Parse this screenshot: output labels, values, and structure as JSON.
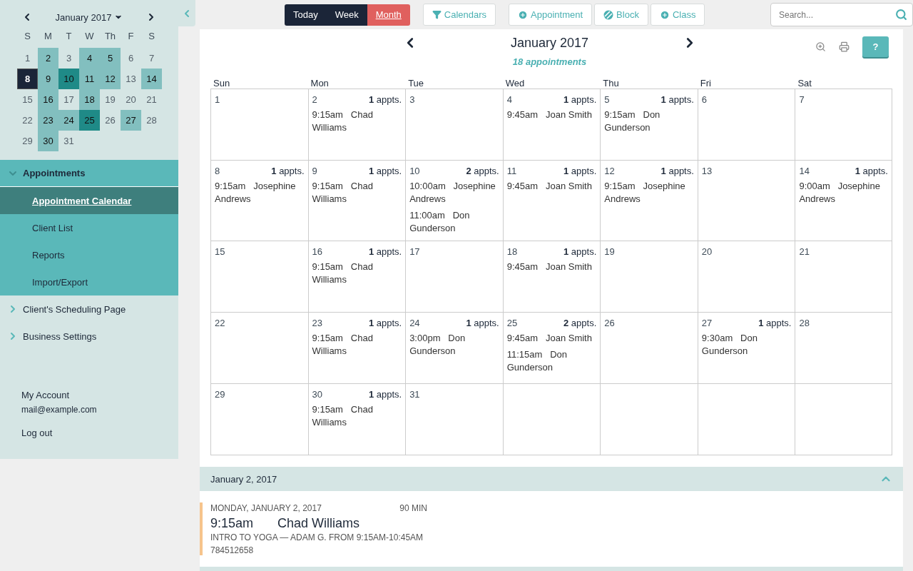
{
  "mini_calendar": {
    "month": "January 2017",
    "weekdays": [
      "S",
      "M",
      "T",
      "W",
      "Th",
      "F",
      "S"
    ],
    "days": [
      {
        "day": "1",
        "kind": "plain",
        "selected": false
      },
      {
        "day": "2",
        "kind": "busy",
        "selected": false
      },
      {
        "day": "3",
        "kind": "plain",
        "selected": false
      },
      {
        "day": "4",
        "kind": "busy",
        "selected": false
      },
      {
        "day": "5",
        "kind": "busy",
        "selected": false
      },
      {
        "day": "6",
        "kind": "plain",
        "selected": false
      },
      {
        "day": "7",
        "kind": "plain",
        "selected": false
      },
      {
        "day": "8",
        "kind": "busy",
        "selected": true
      },
      {
        "day": "9",
        "kind": "busy",
        "selected": false
      },
      {
        "day": "10",
        "kind": "busier",
        "selected": false
      },
      {
        "day": "11",
        "kind": "busy",
        "selected": false
      },
      {
        "day": "12",
        "kind": "busy",
        "selected": false
      },
      {
        "day": "13",
        "kind": "plain",
        "selected": false
      },
      {
        "day": "14",
        "kind": "busy",
        "selected": false
      },
      {
        "day": "15",
        "kind": "plain",
        "selected": false
      },
      {
        "day": "16",
        "kind": "busy",
        "selected": false
      },
      {
        "day": "17",
        "kind": "plain",
        "selected": false
      },
      {
        "day": "18",
        "kind": "busy",
        "selected": false
      },
      {
        "day": "19",
        "kind": "plain",
        "selected": false
      },
      {
        "day": "20",
        "kind": "plain",
        "selected": false
      },
      {
        "day": "21",
        "kind": "plain",
        "selected": false
      },
      {
        "day": "22",
        "kind": "plain",
        "selected": false
      },
      {
        "day": "23",
        "kind": "busy",
        "selected": false
      },
      {
        "day": "24",
        "kind": "busy",
        "selected": false
      },
      {
        "day": "25",
        "kind": "busier",
        "selected": false
      },
      {
        "day": "26",
        "kind": "plain",
        "selected": false
      },
      {
        "day": "27",
        "kind": "busy",
        "selected": false
      },
      {
        "day": "28",
        "kind": "plain",
        "selected": false
      },
      {
        "day": "29",
        "kind": "plain",
        "selected": false
      },
      {
        "day": "30",
        "kind": "busy",
        "selected": false
      },
      {
        "day": "31",
        "kind": "plain",
        "selected": false
      }
    ]
  },
  "nav": [
    {
      "label": "Appointments",
      "expanded": true,
      "children": [
        {
          "label": "Appointment Calendar",
          "selected": true
        },
        {
          "label": "Client List",
          "selected": false
        },
        {
          "label": "Reports",
          "selected": false
        },
        {
          "label": "Import/Export",
          "selected": false
        }
      ]
    },
    {
      "label": "Client's Scheduling Page",
      "expanded": false
    },
    {
      "label": "Business Settings",
      "expanded": false
    }
  ],
  "account": {
    "label": "My Account",
    "email": "mail@example.com",
    "logout": "Log out"
  },
  "view_toggle": [
    {
      "label": "Today",
      "selected": false
    },
    {
      "label": "Week",
      "selected": false
    },
    {
      "label": "Month",
      "selected": true
    }
  ],
  "filter_button": "Calendars",
  "add_buttons": [
    "Appointment",
    "Block",
    "Class"
  ],
  "search": {
    "placeholder": "Search..."
  },
  "calendar": {
    "title": "January 2017",
    "summary": "18 appointments",
    "help": "?",
    "weekdays": [
      "Sun",
      "Mon",
      "Tue",
      "Wed",
      "Thu",
      "Fri",
      "Sat"
    ],
    "weeks": [
      [
        {
          "day": "1"
        },
        {
          "day": "2",
          "count": "**1** appts.",
          "appointments": [
            {
              "time": "9:15am",
              "name": "Chad Williams"
            }
          ]
        },
        {
          "day": "3"
        },
        {
          "day": "4",
          "count": "**1** appts.",
          "appointments": [
            {
              "time": "9:45am",
              "name": "Joan Smith"
            }
          ]
        },
        {
          "day": "5",
          "count": "**1** appts.",
          "appointments": [
            {
              "time": "9:15am",
              "name": "Don Gunderson"
            }
          ]
        },
        {
          "day": "6"
        },
        {
          "day": "7"
        }
      ],
      [
        {
          "day": "8",
          "count": "**1** appts.",
          "appointments": [
            {
              "time": "9:15am",
              "name": "Josephine Andrews"
            }
          ]
        },
        {
          "day": "9",
          "count": "**1** appts.",
          "appointments": [
            {
              "time": "9:15am",
              "name": "Chad Williams"
            }
          ]
        },
        {
          "day": "10",
          "count": "**2** appts.",
          "appointments": [
            {
              "time": "10:00am",
              "name": "Josephine Andrews"
            },
            {
              "time": "11:00am",
              "name": "Don Gunderson"
            }
          ]
        },
        {
          "day": "11",
          "count": "**1** appts.",
          "appointments": [
            {
              "time": "9:45am",
              "name": "Joan Smith"
            }
          ]
        },
        {
          "day": "12",
          "count": "**1** appts.",
          "appointments": [
            {
              "time": "9:15am",
              "name": "Josephine Andrews"
            }
          ]
        },
        {
          "day": "13"
        },
        {
          "day": "14",
          "count": "**1** appts.",
          "appointments": [
            {
              "time": "9:00am",
              "name": "Josephine Andrews"
            }
          ]
        }
      ],
      [
        {
          "day": "15"
        },
        {
          "day": "16",
          "count": "**1** appts.",
          "appointments": [
            {
              "time": "9:15am",
              "name": "Chad Williams"
            }
          ]
        },
        {
          "day": "17"
        },
        {
          "day": "18",
          "count": "**1** appts.",
          "appointments": [
            {
              "time": "9:45am",
              "name": "Joan Smith"
            }
          ]
        },
        {
          "day": "19"
        },
        {
          "day": "20"
        },
        {
          "day": "21"
        }
      ],
      [
        {
          "day": "22"
        },
        {
          "day": "23",
          "count": "**1** appts.",
          "appointments": [
            {
              "time": "9:15am",
              "name": "Chad Williams"
            }
          ]
        },
        {
          "day": "24",
          "count": "**1** appts.",
          "appointments": [
            {
              "time": "3:00pm",
              "name": "Don Gunderson"
            }
          ]
        },
        {
          "day": "25",
          "count": "**2** appts.",
          "appointments": [
            {
              "time": "9:45am",
              "name": "Joan Smith"
            },
            {
              "time": "11:15am",
              "name": "Don Gunderson"
            }
          ]
        },
        {
          "day": "26"
        },
        {
          "day": "27",
          "count": "**1** appts.",
          "appointments": [
            {
              "time": "9:30am",
              "name": "Don Gunderson"
            }
          ]
        },
        {
          "day": "28"
        }
      ],
      [
        {
          "day": "29"
        },
        {
          "day": "30",
          "count": "**1** appts.",
          "appointments": [
            {
              "time": "9:15am",
              "name": "Chad Williams"
            }
          ]
        },
        {
          "day": "31"
        }
      ]
    ]
  },
  "agenda": {
    "date": "January 2, 2017",
    "expanded": true,
    "items": [
      {
        "date": "MONDAY, JANUARY 2, 2017",
        "duration": "90 MIN",
        "time": "9:15am",
        "name": "Chad Williams",
        "details": "INTRO TO YOGA — ADAM G. FROM 9:15AM-10:45AM",
        "phone": "784512658"
      }
    ]
  }
}
